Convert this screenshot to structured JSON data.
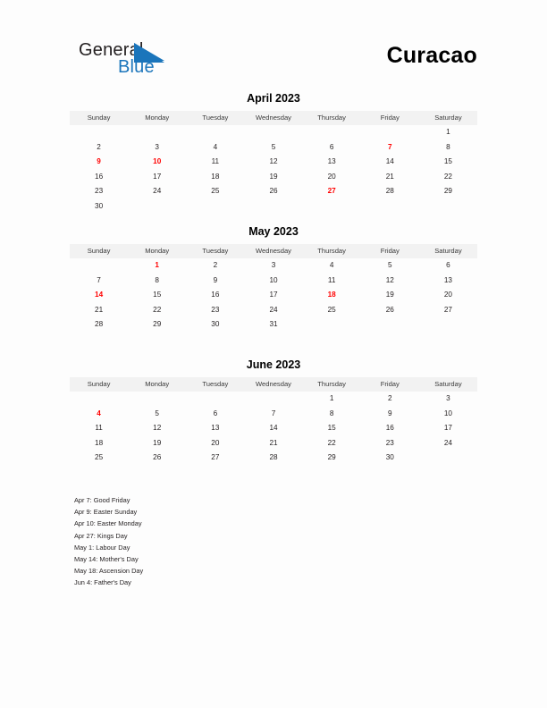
{
  "brand": {
    "logo_primary": "General",
    "logo_secondary": "Blue",
    "accent_color": "#1b75bb",
    "triangle_icon": "logo-triangle-icon"
  },
  "header": {
    "country_title": "Curacao"
  },
  "colors": {
    "holiday_red": "#ff0000",
    "header_row_bg": "#f2f2f2",
    "page_bg": "#fdfdfd",
    "text": "#231f20"
  },
  "weekday_headers": [
    "Sunday",
    "Monday",
    "Tuesday",
    "Wednesday",
    "Thursday",
    "Friday",
    "Saturday"
  ],
  "months": [
    {
      "title": "April 2023",
      "weeks": [
        [
          {
            "d": ""
          },
          {
            "d": ""
          },
          {
            "d": ""
          },
          {
            "d": ""
          },
          {
            "d": ""
          },
          {
            "d": ""
          },
          {
            "d": "1"
          }
        ],
        [
          {
            "d": "2"
          },
          {
            "d": "3"
          },
          {
            "d": "4"
          },
          {
            "d": "5"
          },
          {
            "d": "6"
          },
          {
            "d": "7",
            "holiday": true
          },
          {
            "d": "8"
          }
        ],
        [
          {
            "d": "9",
            "holiday": true
          },
          {
            "d": "10",
            "holiday": true
          },
          {
            "d": "11"
          },
          {
            "d": "12"
          },
          {
            "d": "13"
          },
          {
            "d": "14"
          },
          {
            "d": "15"
          }
        ],
        [
          {
            "d": "16"
          },
          {
            "d": "17"
          },
          {
            "d": "18"
          },
          {
            "d": "19"
          },
          {
            "d": "20"
          },
          {
            "d": "21"
          },
          {
            "d": "22"
          }
        ],
        [
          {
            "d": "23"
          },
          {
            "d": "24"
          },
          {
            "d": "25"
          },
          {
            "d": "26"
          },
          {
            "d": "27",
            "holiday": true
          },
          {
            "d": "28"
          },
          {
            "d": "29"
          }
        ],
        [
          {
            "d": "30"
          },
          {
            "d": ""
          },
          {
            "d": ""
          },
          {
            "d": ""
          },
          {
            "d": ""
          },
          {
            "d": ""
          },
          {
            "d": ""
          }
        ]
      ]
    },
    {
      "title": "May 2023",
      "weeks": [
        [
          {
            "d": ""
          },
          {
            "d": "1",
            "holiday": true
          },
          {
            "d": "2"
          },
          {
            "d": "3"
          },
          {
            "d": "4"
          },
          {
            "d": "5"
          },
          {
            "d": "6"
          }
        ],
        [
          {
            "d": "7"
          },
          {
            "d": "8"
          },
          {
            "d": "9"
          },
          {
            "d": "10"
          },
          {
            "d": "11"
          },
          {
            "d": "12"
          },
          {
            "d": "13"
          }
        ],
        [
          {
            "d": "14",
            "holiday": true
          },
          {
            "d": "15"
          },
          {
            "d": "16"
          },
          {
            "d": "17"
          },
          {
            "d": "18",
            "holiday": true
          },
          {
            "d": "19"
          },
          {
            "d": "20"
          }
        ],
        [
          {
            "d": "21"
          },
          {
            "d": "22"
          },
          {
            "d": "23"
          },
          {
            "d": "24"
          },
          {
            "d": "25"
          },
          {
            "d": "26"
          },
          {
            "d": "27"
          }
        ],
        [
          {
            "d": "28"
          },
          {
            "d": "29"
          },
          {
            "d": "30"
          },
          {
            "d": "31"
          },
          {
            "d": ""
          },
          {
            "d": ""
          },
          {
            "d": ""
          }
        ]
      ]
    },
    {
      "title": "June 2023",
      "weeks": [
        [
          {
            "d": ""
          },
          {
            "d": ""
          },
          {
            "d": ""
          },
          {
            "d": ""
          },
          {
            "d": "1"
          },
          {
            "d": "2"
          },
          {
            "d": "3"
          }
        ],
        [
          {
            "d": "4",
            "holiday": true
          },
          {
            "d": "5"
          },
          {
            "d": "6"
          },
          {
            "d": "7"
          },
          {
            "d": "8"
          },
          {
            "d": "9"
          },
          {
            "d": "10"
          }
        ],
        [
          {
            "d": "11"
          },
          {
            "d": "12"
          },
          {
            "d": "13"
          },
          {
            "d": "14"
          },
          {
            "d": "15"
          },
          {
            "d": "16"
          },
          {
            "d": "17"
          }
        ],
        [
          {
            "d": "18"
          },
          {
            "d": "19"
          },
          {
            "d": "20"
          },
          {
            "d": "21"
          },
          {
            "d": "22"
          },
          {
            "d": "23"
          },
          {
            "d": "24"
          }
        ],
        [
          {
            "d": "25"
          },
          {
            "d": "26"
          },
          {
            "d": "27"
          },
          {
            "d": "28"
          },
          {
            "d": "29"
          },
          {
            "d": "30"
          },
          {
            "d": ""
          }
        ]
      ]
    }
  ],
  "holiday_list": [
    "Apr 7: Good Friday",
    "Apr 9: Easter Sunday",
    "Apr 10: Easter Monday",
    "Apr 27: Kings Day",
    "May 1: Labour Day",
    "May 14: Mother's Day",
    "May 18: Ascension Day",
    "Jun 4: Father's Day"
  ]
}
